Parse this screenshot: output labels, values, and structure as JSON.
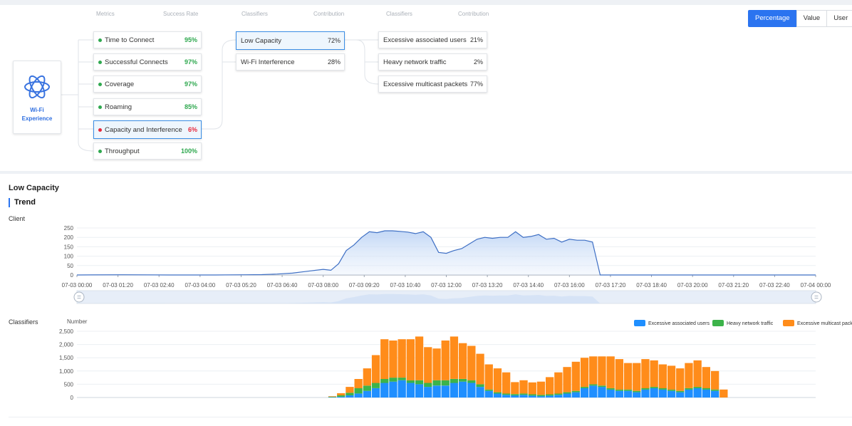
{
  "headers": {
    "metrics": "Metrics",
    "success_rate": "Success Rate",
    "classifiers1": "Classifiers",
    "contribution1": "Contribution",
    "classifiers2": "Classifiers",
    "contribution2": "Contribution"
  },
  "wifi": {
    "line1": "Wi-Fi",
    "line2": "Experience"
  },
  "metrics": [
    {
      "label": "Time to Connect",
      "value": "95%",
      "status": "good"
    },
    {
      "label": "Successful Connects",
      "value": "97%",
      "status": "good"
    },
    {
      "label": "Coverage",
      "value": "97%",
      "status": "good"
    },
    {
      "label": "Roaming",
      "value": "85%",
      "status": "good"
    },
    {
      "label": "Capacity and Interference",
      "value": "6%",
      "status": "bad"
    },
    {
      "label": "Throughput",
      "value": "100%",
      "status": "good"
    }
  ],
  "classifiers": [
    {
      "label": "Low Capacity",
      "value": "72%"
    },
    {
      "label": "Wi-Fi Interference",
      "value": "28%"
    }
  ],
  "sub_classifiers": [
    {
      "label": "Excessive associated users",
      "value": "21%"
    },
    {
      "label": "Heavy network traffic",
      "value": "2%"
    },
    {
      "label": "Excessive multicast packets",
      "value": "77%"
    }
  ],
  "toggle": [
    "Percentage",
    "Value",
    "User"
  ],
  "section_title": "Low Capacity",
  "trend_title": "Trend",
  "client_label": "Client",
  "classifiers_label": "Classifiers",
  "number_label": "Number",
  "colors": {
    "good": "#2fa84f",
    "bad": "#e8283c",
    "accent": "#2b74f0",
    "blue": "#1f8fff",
    "green": "#3cb34a",
    "orange": "#ff8c1a"
  },
  "chart_data": [
    {
      "type": "area",
      "ylabel": "Client",
      "ylim": [
        0,
        250
      ],
      "yticks": [
        0,
        50,
        100,
        150,
        200,
        250
      ],
      "x_tick_labels": [
        "07-03 00:00",
        "07-03 01:20",
        "07-03 02:40",
        "07-03 04:00",
        "07-03 05:20",
        "07-03 06:40",
        "07-03 08:00",
        "07-03 09:20",
        "07-03 10:40",
        "07-03 12:00",
        "07-03 13:20",
        "07-03 14:40",
        "07-03 16:00",
        "07-03 17:20",
        "07-03 18:40",
        "07-03 20:00",
        "07-03 21:20",
        "07-03 22:40",
        "07-04 00:00"
      ],
      "x_hours": [
        0,
        1.5,
        3,
        4.5,
        5.5,
        6,
        6.5,
        7,
        7.5,
        8,
        8.25,
        8.5,
        8.75,
        9,
        9.25,
        9.5,
        9.75,
        10,
        10.25,
        10.5,
        10.75,
        11,
        11.25,
        11.5,
        11.75,
        12,
        12.25,
        12.5,
        12.75,
        13,
        13.25,
        13.5,
        13.75,
        14,
        14.25,
        14.5,
        14.75,
        15,
        15.25,
        15.5,
        15.75,
        16,
        16.25,
        16.5,
        16.75,
        17,
        17.25,
        18,
        20,
        22,
        24
      ],
      "y": [
        0,
        1,
        0,
        0,
        1,
        2,
        5,
        10,
        20,
        30,
        25,
        60,
        130,
        160,
        200,
        230,
        225,
        235,
        235,
        232,
        228,
        220,
        230,
        200,
        120,
        115,
        130,
        140,
        165,
        190,
        200,
        195,
        200,
        200,
        230,
        200,
        205,
        215,
        190,
        195,
        175,
        190,
        185,
        185,
        175,
        0,
        0,
        0,
        0,
        0,
        0
      ]
    },
    {
      "type": "bar",
      "stacked": true,
      "ylabel": "Number",
      "ylim": [
        0,
        2500
      ],
      "yticks": [
        0,
        500,
        1000,
        1500,
        2000,
        2500
      ],
      "legend": "top-right",
      "series": [
        {
          "name": "Excessive associated users",
          "color": "#1f8fff"
        },
        {
          "name": "Heavy network traffic",
          "color": "#3cb34a"
        },
        {
          "name": "Excessive multicast packets",
          "color": "#ff8c1a"
        }
      ],
      "blue": [
        10,
        30,
        80,
        150,
        250,
        350,
        550,
        600,
        650,
        550,
        500,
        400,
        450,
        450,
        550,
        600,
        550,
        400,
        250,
        150,
        100,
        80,
        100,
        70,
        50,
        70,
        100,
        150,
        200,
        350,
        450,
        400,
        300,
        250,
        250,
        200,
        300,
        350,
        300,
        250,
        200,
        300,
        350,
        300,
        250,
        0
      ],
      "green": [
        20,
        50,
        100,
        200,
        200,
        200,
        150,
        150,
        100,
        100,
        150,
        150,
        200,
        200,
        150,
        100,
        100,
        100,
        50,
        50,
        50,
        50,
        50,
        50,
        50,
        50,
        50,
        50,
        50,
        50,
        50,
        50,
        50,
        50,
        50,
        50,
        50,
        50,
        50,
        50,
        50,
        50,
        50,
        50,
        50,
        0
      ],
      "orange": [
        20,
        80,
        220,
        350,
        650,
        1050,
        1500,
        1400,
        1450,
        1550,
        1650,
        1350,
        1200,
        1500,
        1600,
        1350,
        1300,
        1150,
        950,
        900,
        800,
        450,
        500,
        450,
        500,
        650,
        800,
        950,
        1100,
        1100,
        1050,
        1100,
        1200,
        1150,
        1000,
        1050,
        1100,
        1000,
        900,
        900,
        850,
        950,
        1000,
        800,
        700,
        300
      ],
      "first_bar_hour": 9.0,
      "bar_step_hours": 0.25
    }
  ]
}
